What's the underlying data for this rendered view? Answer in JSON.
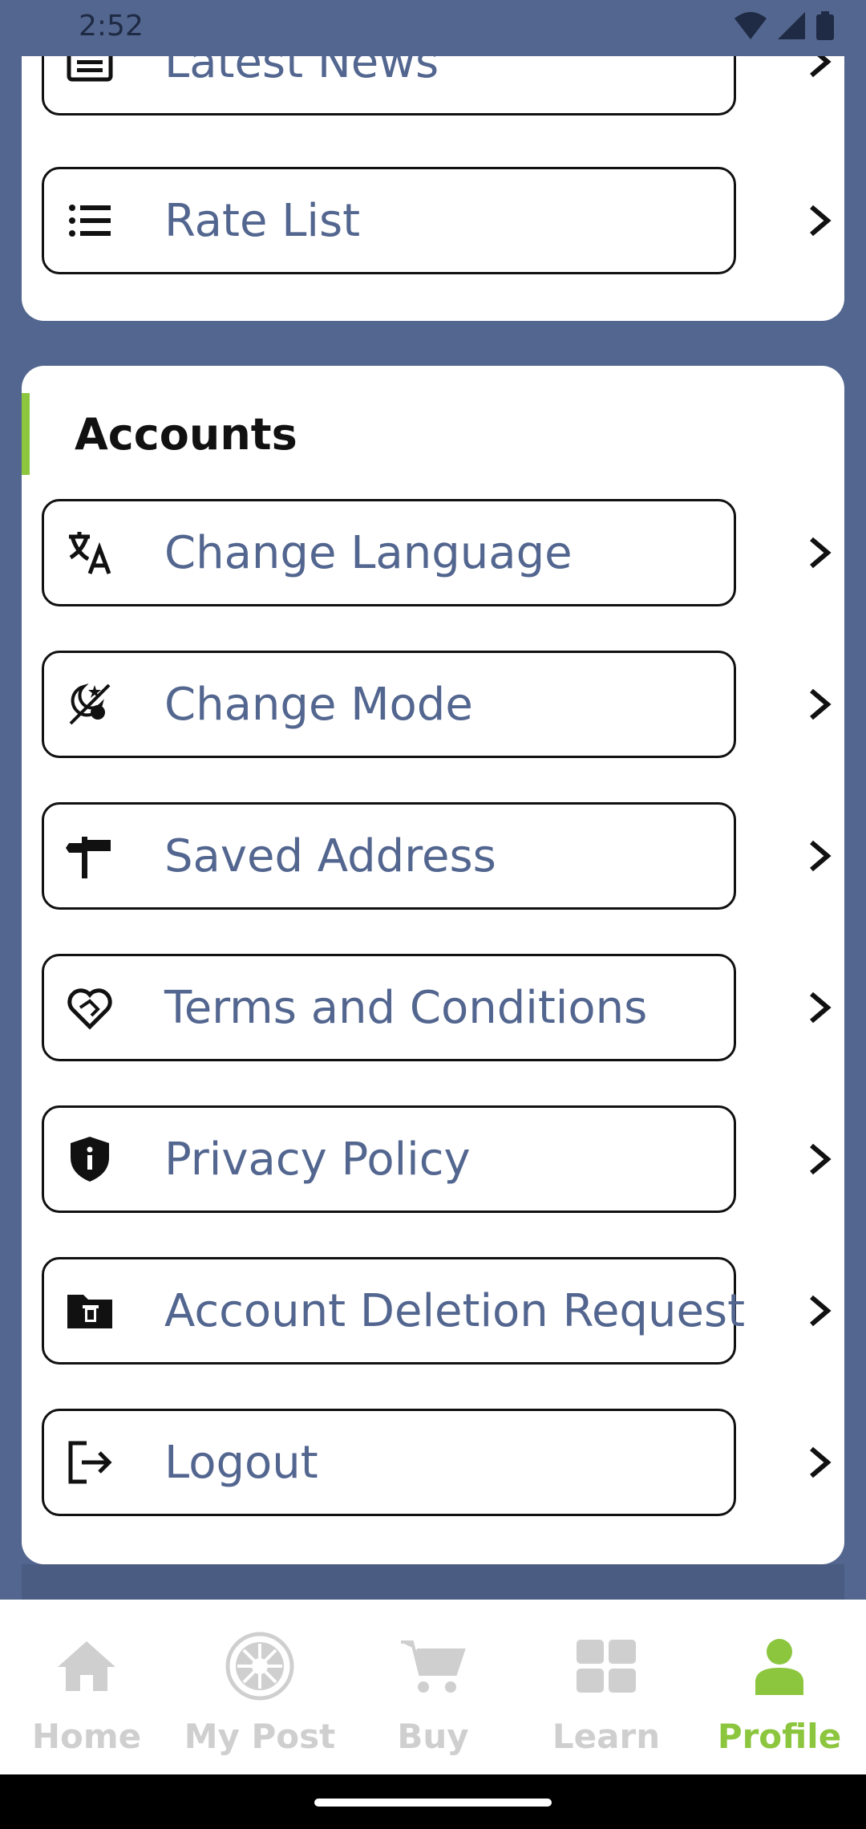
{
  "status": {
    "time": "2:52"
  },
  "top_section": {
    "items": [
      {
        "label": "Latest News",
        "icon": "newspaper-icon"
      },
      {
        "label": "Rate List",
        "icon": "list-icon"
      }
    ]
  },
  "accounts": {
    "heading": "Accounts",
    "items": [
      {
        "label": "Change Language",
        "icon": "translate-icon"
      },
      {
        "label": "Change Mode",
        "icon": "day-night-icon"
      },
      {
        "label": "Saved Address",
        "icon": "signpost-icon"
      },
      {
        "label": "Terms and Conditions",
        "icon": "heart-handshake-icon"
      },
      {
        "label": "Privacy Policy",
        "icon": "shield-info-icon"
      },
      {
        "label": "Account Deletion Request",
        "icon": "folder-delete-icon"
      },
      {
        "label": "Logout",
        "icon": "logout-icon"
      }
    ]
  },
  "bottom_nav": {
    "items": [
      {
        "label": "Home",
        "icon": "home-icon",
        "active": false
      },
      {
        "label": "My Post",
        "icon": "post-icon",
        "active": false
      },
      {
        "label": "Buy",
        "icon": "cart-icon",
        "active": false
      },
      {
        "label": "Learn",
        "icon": "grid-icon",
        "active": false
      },
      {
        "label": "Profile",
        "icon": "person-icon",
        "active": true
      }
    ]
  },
  "colors": {
    "background": "#53668f",
    "accent": "#8cc63f",
    "label_text": "#53668f",
    "inactive_nav": "#cfcfcf"
  }
}
